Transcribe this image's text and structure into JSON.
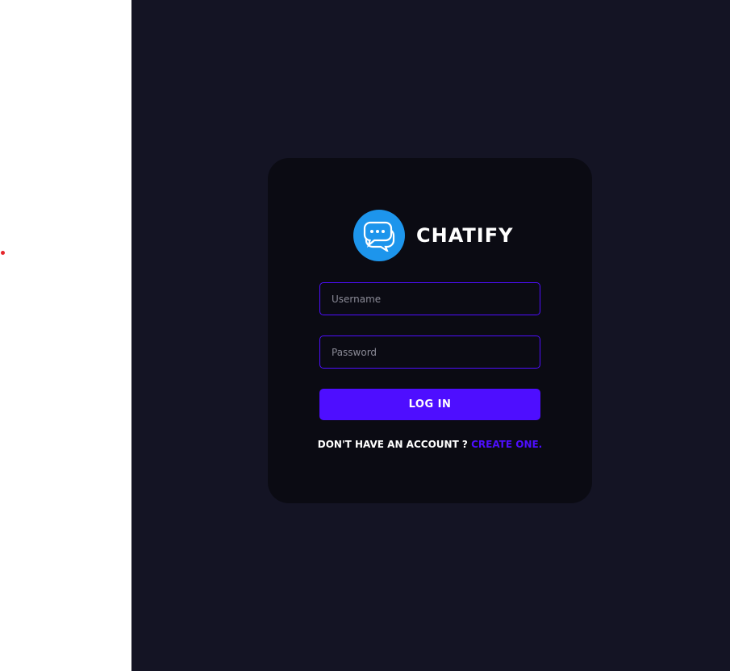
{
  "app": {
    "brand_name": "CHATIFY",
    "logo_icon": "chat-bubbles-icon"
  },
  "form": {
    "username_placeholder": "Username",
    "password_placeholder": "Password",
    "login_label": "LOG IN",
    "signup_prompt": "DON'T HAVE AN ACCOUNT ?",
    "signup_link": "CREATE ONE."
  },
  "colors": {
    "background": "#141424",
    "card": "#0b0b13",
    "accent": "#4e0eff",
    "logo": "#1d95ec",
    "text": "#ffffff"
  }
}
